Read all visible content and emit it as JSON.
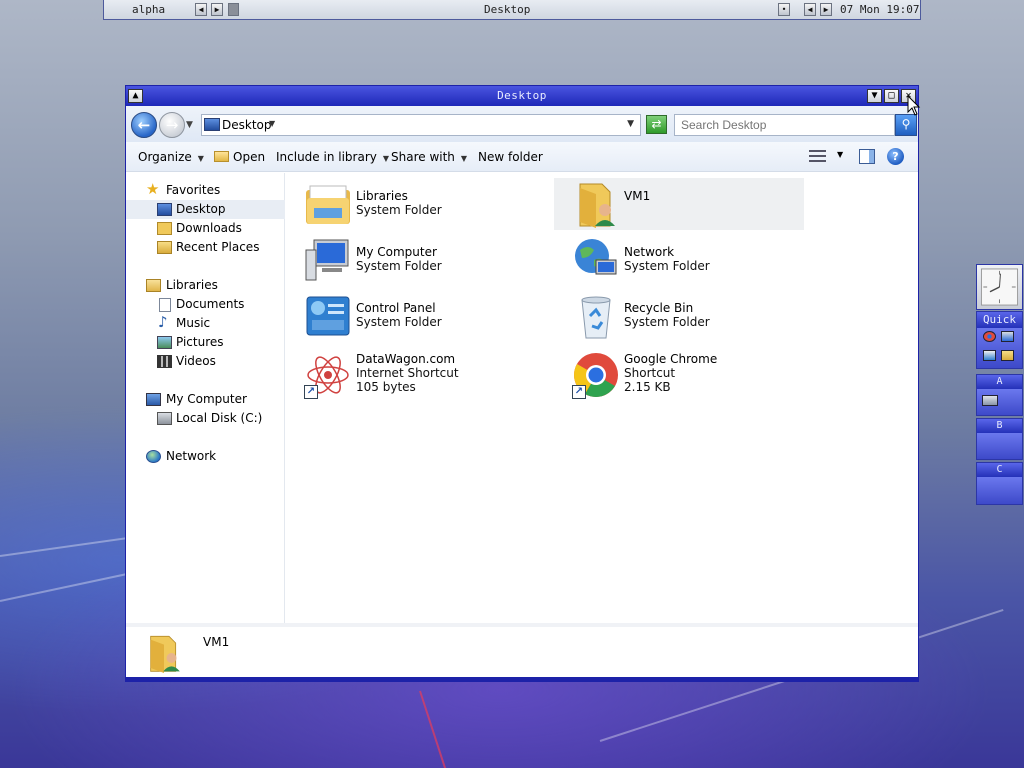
{
  "top_panel": {
    "workspace": "alpha",
    "center_title": "Desktop",
    "clock": "07 Mon 19:07"
  },
  "window": {
    "title": "Desktop",
    "address": "Desktop",
    "search_placeholder": "Search Desktop"
  },
  "toolbar": {
    "organize": "Organize",
    "open": "Open",
    "include_in_library": "Include in library",
    "share_with": "Share with",
    "new_folder": "New folder"
  },
  "nav_pane": {
    "favorites": {
      "label": "Favorites",
      "items": [
        "Desktop",
        "Downloads",
        "Recent Places"
      ]
    },
    "libraries": {
      "label": "Libraries",
      "items": [
        "Documents",
        "Music",
        "Pictures",
        "Videos"
      ]
    },
    "computer": {
      "label": "My Computer",
      "items": [
        "Local Disk (C:)"
      ]
    },
    "network": "Network"
  },
  "items": [
    {
      "name": "Libraries",
      "type": "System Folder",
      "size": "",
      "icon": "libraries-icon"
    },
    {
      "name": "VM1",
      "type": "",
      "size": "",
      "icon": "user-folder-icon"
    },
    {
      "name": "My Computer",
      "type": "System Folder",
      "size": "",
      "icon": "computer-icon"
    },
    {
      "name": "Network",
      "type": "System Folder",
      "size": "",
      "icon": "network-icon"
    },
    {
      "name": "Control Panel",
      "type": "System Folder",
      "size": "",
      "icon": "control-panel-icon"
    },
    {
      "name": "Recycle Bin",
      "type": "System Folder",
      "size": "",
      "icon": "recycle-bin-icon"
    },
    {
      "name": "DataWagon.com",
      "type": "Internet Shortcut",
      "size": "105 bytes",
      "icon": "web-shortcut-icon"
    },
    {
      "name": "Google Chrome",
      "type": "Shortcut",
      "size": "2.15 KB",
      "icon": "chrome-icon"
    }
  ],
  "details_pane": {
    "name": "VM1"
  },
  "dock": {
    "quick_label": "Quick",
    "groups": [
      "A",
      "B",
      "C"
    ]
  },
  "colors": {
    "window_border": "#1d22a8",
    "titlebar": "#2a36c8",
    "selection": "#e8edf4"
  }
}
